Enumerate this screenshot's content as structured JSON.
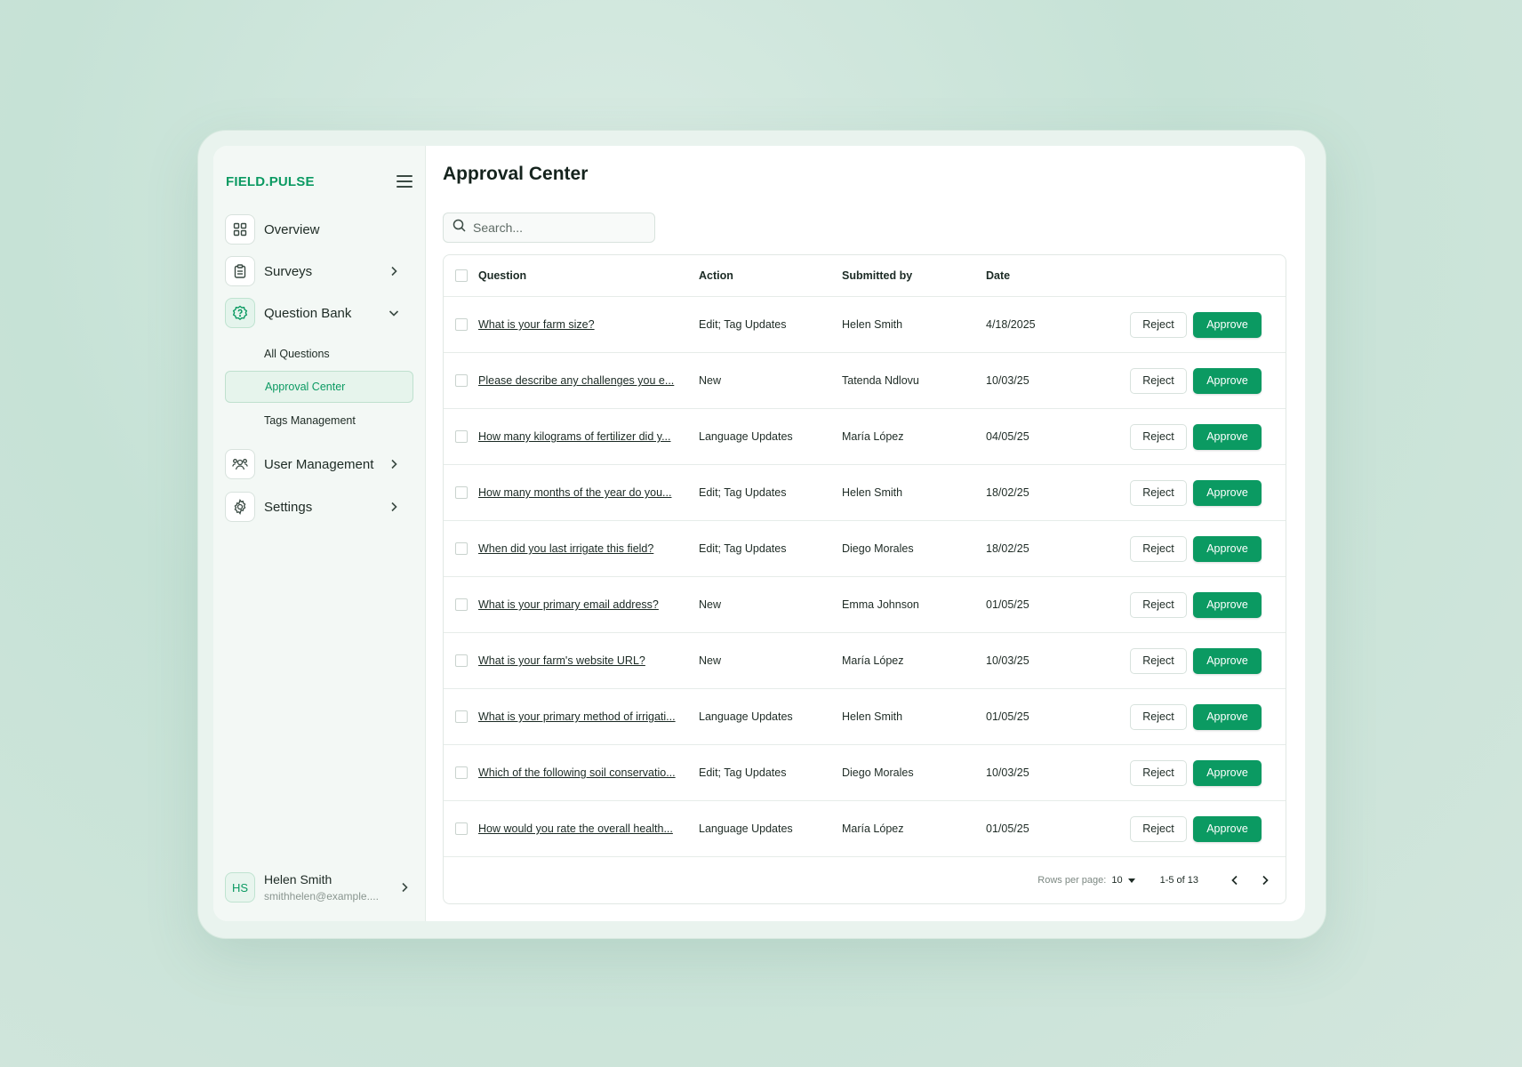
{
  "brand": "FIELD.PULSE",
  "nav": {
    "overview": "Overview",
    "surveys": "Surveys",
    "question_bank": "Question Bank",
    "sub": {
      "all_questions": "All Questions",
      "approval_center": "Approval Center",
      "tags_management": "Tags Management"
    },
    "user_management": "User Management",
    "settings": "Settings"
  },
  "user": {
    "initials": "HS",
    "name": "Helen Smith",
    "email": "smithhelen@example...."
  },
  "page": {
    "title": "Approval Center"
  },
  "search": {
    "placeholder": "Search..."
  },
  "table": {
    "headers": {
      "question": "Question",
      "action": "Action",
      "submitted_by": "Submitted by",
      "date": "Date"
    },
    "buttons": {
      "reject": "Reject",
      "approve": "Approve"
    },
    "rows": [
      {
        "question": "What is your farm size?",
        "action": "Edit; Tag Updates",
        "submitted_by": "Helen Smith",
        "date": "4/18/2025"
      },
      {
        "question": "Please describe any challenges you e...",
        "action": "New",
        "submitted_by": "Tatenda Ndlovu",
        "date": "10/03/25"
      },
      {
        "question": "How many kilograms of fertilizer did y...",
        "action": "Language Updates",
        "submitted_by": "María López",
        "date": "04/05/25"
      },
      {
        "question": "How many months of the year do you...",
        "action": "Edit; Tag Updates",
        "submitted_by": "Helen Smith",
        "date": "18/02/25"
      },
      {
        "question": "When did you last irrigate this field?",
        "action": "Edit; Tag Updates",
        "submitted_by": "Diego Morales",
        "date": "18/02/25"
      },
      {
        "question": "What is your primary email address?",
        "action": "New",
        "submitted_by": "Emma Johnson",
        "date": "01/05/25"
      },
      {
        "question": "What is your farm's website URL?",
        "action": "New",
        "submitted_by": "María López",
        "date": "10/03/25"
      },
      {
        "question": "What is your primary method of irrigati...",
        "action": "Language Updates",
        "submitted_by": "Helen Smith",
        "date": "01/05/25"
      },
      {
        "question": "Which of the following soil conservatio...",
        "action": "Edit; Tag Updates",
        "submitted_by": "Diego Morales",
        "date": "10/03/25"
      },
      {
        "question": "How would you rate the overall health...",
        "action": "Language Updates",
        "submitted_by": "María López",
        "date": "01/05/25"
      }
    ]
  },
  "pagination": {
    "rows_per_page_label": "Rows per page:",
    "rows_per_page": "10",
    "range": "1-5 of 13"
  },
  "colors": {
    "accent": "#0b9a62",
    "sidebar_bg": "#f3f8f5",
    "page_bg": "#cfe6db"
  },
  "icons": {
    "menu": "hamburger-menu-icon",
    "overview": "grid-icon",
    "surveys": "clipboard-icon",
    "question_bank": "badge-question-icon",
    "user_management": "users-icon",
    "settings": "gear-icon",
    "search": "search-icon",
    "filter": "filter-icon"
  }
}
